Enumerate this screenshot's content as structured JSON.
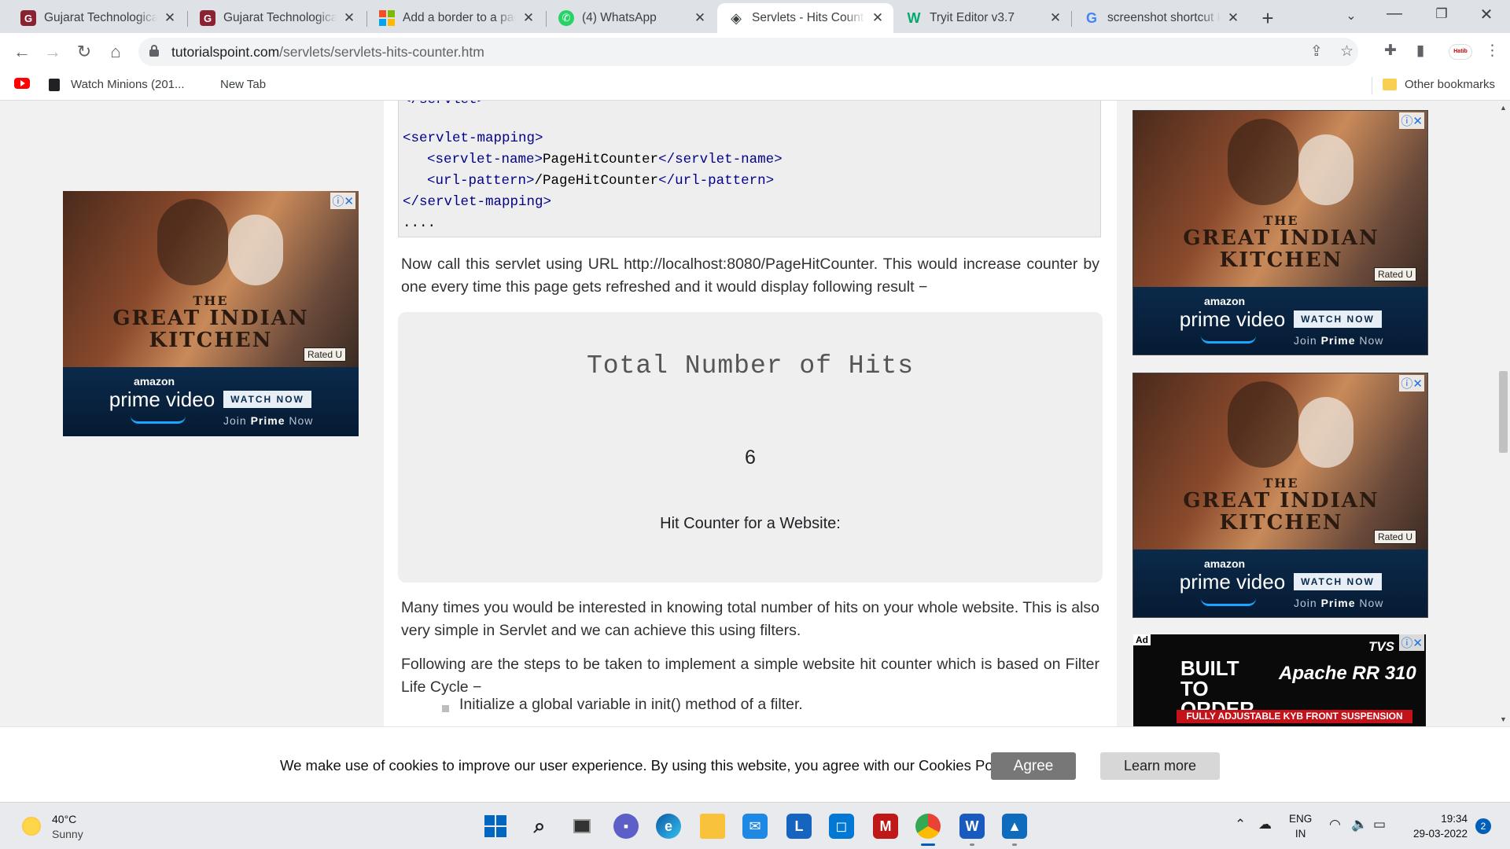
{
  "tabs": [
    {
      "title": "Gujarat Technological",
      "icon": "gtu-icon",
      "color": "#8b2232"
    },
    {
      "title": "Gujarat Technological",
      "icon": "gtu-icon",
      "color": "#8b2232"
    },
    {
      "title": "Add a border to a page",
      "icon": "microsoft-icon",
      "color": "#f25022"
    },
    {
      "title": "(4) WhatsApp",
      "icon": "whatsapp-icon",
      "color": "#25d366"
    },
    {
      "title": "Servlets - Hits Counter",
      "icon": "tutorialspoint-icon",
      "color": "#3c4043",
      "active": true
    },
    {
      "title": "Tryit Editor v3.7",
      "icon": "w3schools-icon",
      "color": "#04aa6d"
    },
    {
      "title": "screenshot shortcut key",
      "icon": "google-icon",
      "color": "#4285f4"
    }
  ],
  "address_bar": {
    "host": "tutorialspoint.com",
    "path": "/servlets/servlets-hits-counter.htm"
  },
  "bookmarks": {
    "item1": "Watch Minions (201...",
    "item2": "New Tab",
    "other": "Other bookmarks"
  },
  "code": {
    "line0": "</servlet>",
    "line1": "<servlet-mapping>",
    "line2_open": "<servlet-name>",
    "line2_text": "PageHitCounter",
    "line2_close": "</servlet-name>",
    "line3_open": "<url-pattern>",
    "line3_text": "/PageHitCounter",
    "line3_close": "</url-pattern>",
    "line4": "</servlet-mapping>",
    "line5": "...."
  },
  "content": {
    "para1": "Now call this servlet using URL http://localhost:8080/PageHitCounter. This would increase counter by one every time this page gets refreshed and it would display following result −",
    "result_title": "Total Number of Hits",
    "result_count": "6",
    "result_caption": "Hit Counter for a Website:",
    "para2": "Many times you would be interested in knowing total number of hits on your whole website. This is also very simple in Servlet and we can achieve this using filters.",
    "para3": "Following are the steps to be taken to implement a simple website hit counter which is based on Filter Life Cycle −",
    "bullet1": "Initialize a global variable in init() method of a filter."
  },
  "ad_movie": {
    "title_line1": "THE",
    "title_line2": "GREAT INDIAN",
    "title_line3": "KITCHEN",
    "rated": "Rated U",
    "brand_small": "amazon",
    "brand_big": "prime video",
    "cta": "WATCH NOW",
    "join_prefix": "Join ",
    "join_bold": "Prime",
    "join_suffix": " Now",
    "choice": "ⓘ✕"
  },
  "ad_tvs": {
    "tag": "Ad",
    "logo": "TVS",
    "built": "BUILT TO ORDER",
    "model": "Apache RR 310",
    "strip": "FULLY ADJUSTABLE KYB FRONT SUSPENSION"
  },
  "cookie": {
    "text": "We make use of cookies to improve our user experience. By using this website, you agree with our Cookies Policy.",
    "agree": "Agree",
    "learn_more": "Learn more"
  },
  "taskbar": {
    "temp": "40°C",
    "weather": "Sunny",
    "lang1": "ENG",
    "lang2": "IN",
    "time": "19:34",
    "date": "29-03-2022",
    "notifications": "2"
  }
}
